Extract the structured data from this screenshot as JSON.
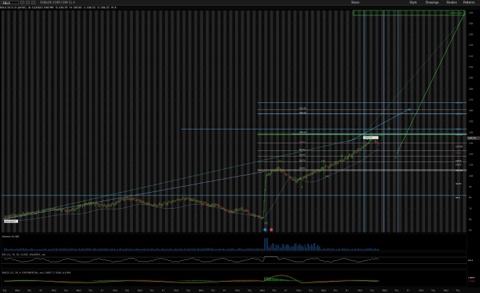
{
  "toolbar": {
    "symbol": "RBLX",
    "company": "ROBLOX CORP COM CL A",
    "right_buttons": [
      "Share",
      "Style",
      "Drawings",
      "Studies",
      "Patterns"
    ]
  },
  "info_bar": {
    "chart_label": "RBLX 3D D 1h [NYSE]",
    "date": "D: 11/19/21 3:00 PM",
    "open": "O: 134.75",
    "high": "H: 135.03",
    "low": "L: 134.72",
    "close": "C: 134.72",
    "change": "R: 0"
  },
  "last_price": "134.72",
  "price_axis": [
    "250",
    "240",
    "230",
    "220",
    "210",
    "200",
    "190",
    "180",
    "170",
    "160",
    "150",
    "140",
    "130",
    "120",
    "110",
    "100",
    "90",
    "80",
    "70",
    "60",
    "50"
  ],
  "fib_levels": [
    {
      "label": "161.8%",
      "price": 161
    },
    {
      "label": "150.0%",
      "price": 157
    },
    {
      "label": "100.0%",
      "price": 138.8
    },
    {
      "label": "78.6%",
      "price": 130
    },
    {
      "label": "61.8%",
      "price": 123
    },
    {
      "label": "50.0%",
      "price": 118
    },
    {
      "label": "38.2%",
      "price": 113
    },
    {
      "label": "23.6%",
      "price": 106
    }
  ],
  "level_tags": [
    "167.39",
    "157.04",
    "143.1",
    "138.28",
    "137.98",
    "127.06",
    "121.1",
    "113.9",
    "110.5",
    "104.96",
    "92.63",
    "80.1"
  ],
  "wave_labels": [
    "(1)",
    "(2)",
    "(3)",
    "(4)",
    "(5)",
    "1",
    "2",
    "3",
    "4",
    "5",
    "iii",
    "iv",
    "v"
  ],
  "annotations": {
    "low_tag": "Low: 60.77",
    "peak_tag": "134.72",
    "gap_note": "5 green days"
  },
  "date_axis": [
    "Tue",
    "Wed",
    "Thu",
    "Fri",
    "Mon",
    "Tue",
    "Wed",
    "Thu",
    "Fri",
    "Mon",
    "Tue",
    "Wed",
    "Thu",
    "Fri",
    "Mon",
    "Tue",
    "Wed",
    "Thu",
    "Fri",
    "Mon",
    "Tue",
    "Wed",
    "Thu",
    "Fri",
    "Mon",
    "Tue",
    "Wed",
    "Thu",
    "Fri",
    "Mon",
    "Tue",
    "Wed",
    "Thu",
    "Fri",
    "Mon",
    "Tue",
    "Wed",
    "Thu"
  ],
  "panels": {
    "volume": "Volume",
    "volume_value": "44,961",
    "rsi": "RSI (14, 70, 30, CLOSE, WILDERS, no)",
    "rsi_value": "63.4",
    "macd": "MACD (12, 26, 9, EXPONENTIAL, no)",
    "macd_values": [
      "2.6837",
      "2.7006",
      "-0.0169"
    ]
  },
  "colors": {
    "up": "#3cdc3c",
    "down": "#e03030",
    "fib": "#4fb6e6",
    "trend": "#4bd24b",
    "background": "#000000"
  }
}
